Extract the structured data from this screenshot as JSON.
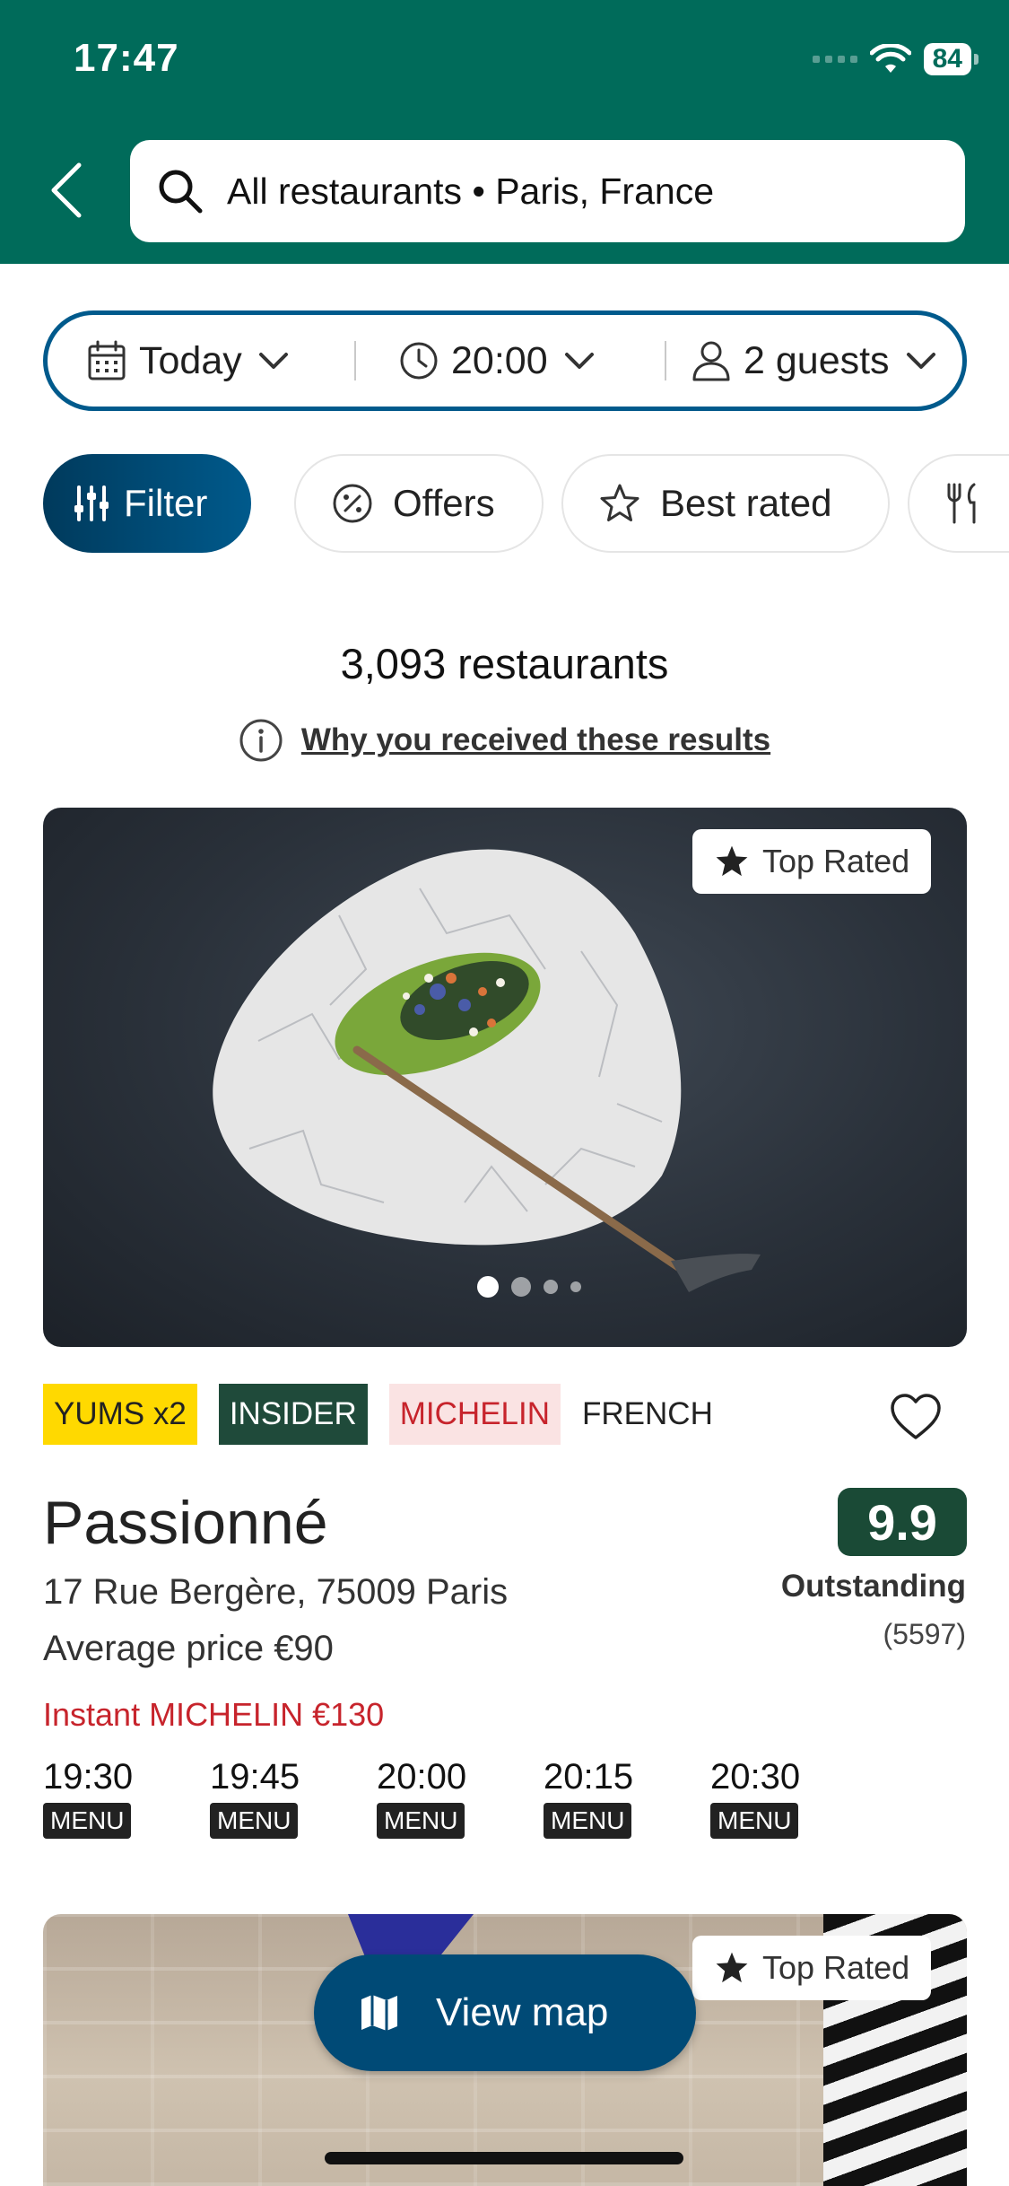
{
  "status_bar": {
    "time": "17:47",
    "battery": "84"
  },
  "search": {
    "text": "All restaurants • Paris, France"
  },
  "booking": {
    "date": "Today",
    "time": "20:00",
    "guests": "2 guests"
  },
  "chips": {
    "filter": "Filter",
    "offers": "Offers",
    "best_rated": "Best rated"
  },
  "results": {
    "count": "3,093 restaurants",
    "why_link": "Why you received these results"
  },
  "card": {
    "badge": "Top Rated",
    "tags": [
      "YUMS x2",
      "INSIDER",
      "MICHELIN",
      "FRENCH"
    ],
    "name": "Passionné",
    "address": "17 Rue Bergère, 75009 Paris",
    "price": "Average price €90",
    "offer": "Instant MICHELIN €130",
    "score": "9.9",
    "score_label": "Outstanding",
    "review_count": "(5597)",
    "slots": [
      {
        "time": "19:30",
        "label": "MENU"
      },
      {
        "time": "19:45",
        "label": "MENU"
      },
      {
        "time": "20:00",
        "label": "MENU"
      },
      {
        "time": "20:15",
        "label": "MENU"
      },
      {
        "time": "20:30",
        "label": "MENU"
      }
    ]
  },
  "card2": {
    "badge": "Top Rated"
  },
  "view_map": {
    "label": "View map"
  },
  "colors": {
    "header": "#006b5a",
    "accent": "#005a8c",
    "score": "#1a4a36",
    "michelin": "#c7242c",
    "yums": "#ffd900"
  }
}
